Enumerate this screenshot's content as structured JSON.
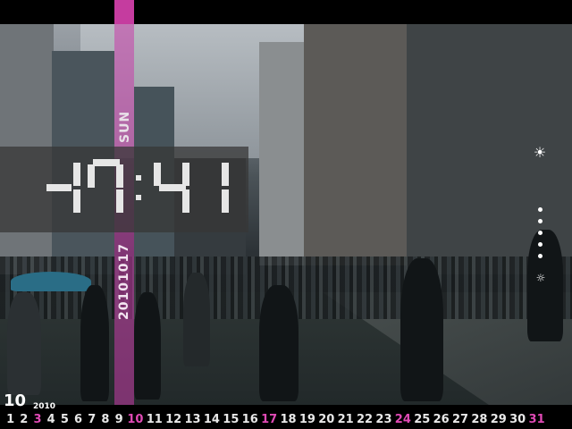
{
  "clock": {
    "time_digits": [
      "1",
      "7",
      "4",
      "1"
    ],
    "day_of_week": "SUN",
    "date": "20101017"
  },
  "calendar": {
    "month": "10",
    "year": "2010",
    "days": [
      "1",
      "2",
      "3",
      "4",
      "5",
      "6",
      "7",
      "8",
      "9",
      "10",
      "11",
      "12",
      "13",
      "14",
      "15",
      "16",
      "17",
      "18",
      "19",
      "20",
      "21",
      "22",
      "23",
      "24",
      "25",
      "26",
      "27",
      "28",
      "29",
      "30",
      "31"
    ],
    "highlighted_days": [
      "3",
      "10",
      "17",
      "24",
      "31"
    ]
  },
  "controls": {
    "brightness_icon": "sun-icon",
    "level_dots": 5
  },
  "colors": {
    "accent_pink": "#c53c9f",
    "highlight_pink": "#e04ab5",
    "text_white": "#e8e8e8"
  }
}
